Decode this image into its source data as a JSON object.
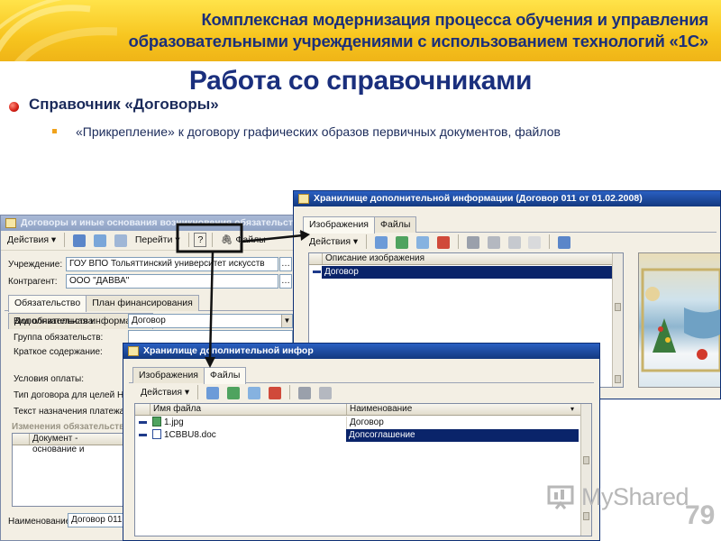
{
  "header": {
    "line1": "Комплексная модернизация процесса обучения и управления",
    "line2": "образовательными учреждениями с использованием технологий «1С»"
  },
  "slide": {
    "title": "Работа со справочниками",
    "bullet1": "Справочник «Договоры»",
    "bullet2": "«Прикрепление» к договору графических образов первичных документов, файлов"
  },
  "main_window": {
    "title": "Договоры и иные основания возникновения обязательств:",
    "toolbar": {
      "actions": "Действия",
      "goto": "Перейти",
      "help": "?",
      "files": "Файлы"
    },
    "fields": [
      {
        "label": "Учреждение:",
        "value": "ГОУ ВПО Тольяттинский университет искусств"
      },
      {
        "label": "Контрагент:",
        "value": "ООО \"ДАВВА\""
      }
    ],
    "tabs": [
      "Обязательство",
      "План финансирования",
      "Дополнительная информация"
    ],
    "form_labels": {
      "kind": "Вид обязательства:",
      "group": "Группа обязательств:",
      "summary": "Краткое содержание:",
      "payment": "Условия оплаты:",
      "contract_type": "Тип договора для целей НД",
      "purpose": "Текст назначения платежа:",
      "changes": "Изменения обязательств",
      "doc_column": "Документ - основание и"
    },
    "kind_value": "Договор",
    "name_label": "Наименование:",
    "name_value": "Договор 011"
  },
  "storage_window_top": {
    "title": "Хранилище дополнительной информации (Договор 011 от 01.02.2008)",
    "tabs": [
      "Изображения",
      "Файлы"
    ],
    "actions": "Действия",
    "column": "Описание изображения",
    "rows": [
      "Договор"
    ]
  },
  "storage_window_front": {
    "title": "Хранилище дополнительной инфор",
    "tabs": [
      "Изображения",
      "Файлы"
    ],
    "actions": "Действия",
    "columns": [
      "Имя файла",
      "Наименование"
    ],
    "rows": [
      {
        "file": "1.jpg",
        "name": "Договор"
      },
      {
        "file": "1CBBU8.doc",
        "name": "Допсоглашение"
      }
    ]
  },
  "watermark": "MyShared",
  "page_number": "79",
  "colors": {
    "title": "#1a2f7d",
    "titlebar": "#2a5fc2",
    "selection": "#0a246a",
    "banner": "#f7c51f"
  }
}
